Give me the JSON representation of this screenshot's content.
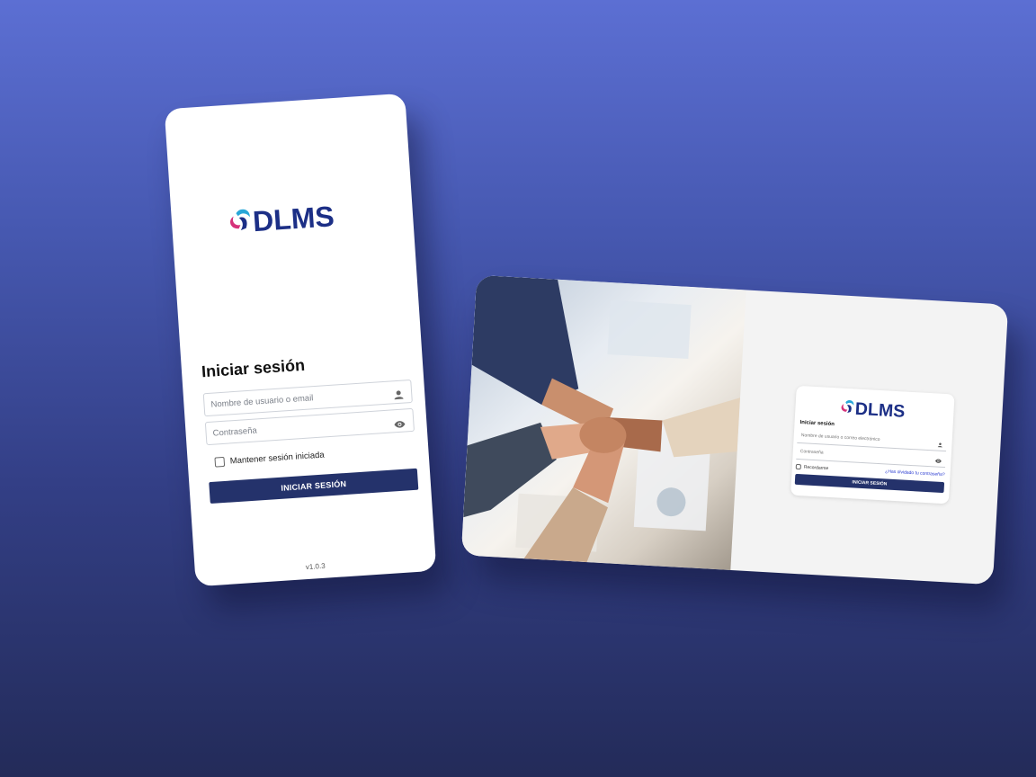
{
  "mobile": {
    "logo_text": "DLMS",
    "title": "Iniciar sesión",
    "username_placeholder": "Nombre de usuario o email",
    "password_placeholder": "Contraseña",
    "remember_label": "Mantener sesión iniciada",
    "login_button": "INICIAR SESIÓN",
    "version": "v1.0.3"
  },
  "desktop": {
    "logo_text": "DLMS",
    "title": "Iniciar sesión",
    "username_placeholder": "Nombre de usuario o correo electrónico",
    "password_placeholder": "Contraseña",
    "remember_label": "Recordarme",
    "forgot_link": "¿Has olvidado tu contraseña?",
    "login_button": "INICIAR SESIÓN",
    "image_subject": "team-hands-together-photo"
  },
  "icons": {
    "user": "user-icon",
    "eye": "eye-icon",
    "logo_mark": "dlms-logo-mark"
  },
  "colors": {
    "brand_navy": "#24326b",
    "logo_blue": "#1c2f86",
    "logo_pink": "#d6327a",
    "logo_cyan": "#2aa7d8",
    "link_blue": "#2a3bd1",
    "background_top": "#5c6fd3",
    "background_bottom": "#232b59"
  }
}
